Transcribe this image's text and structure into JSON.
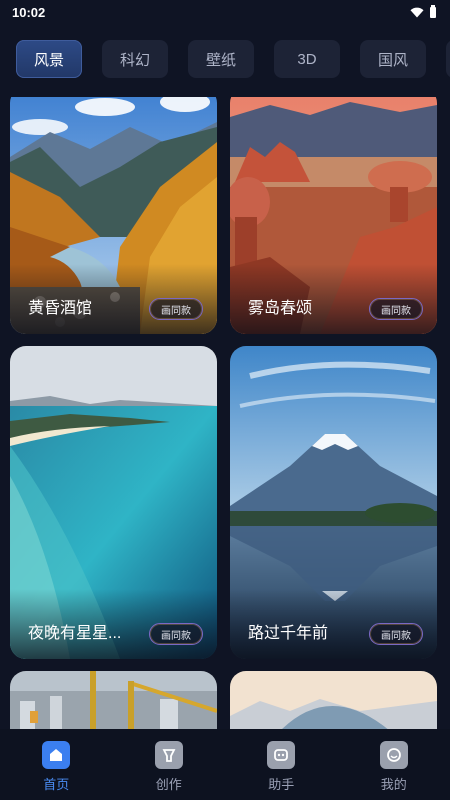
{
  "status": {
    "time": "10:02"
  },
  "tabs": [
    {
      "label": "风景",
      "active": true
    },
    {
      "label": "科幻"
    },
    {
      "label": "壁纸"
    },
    {
      "label": "3D"
    },
    {
      "label": "国风"
    },
    {
      "label": ""
    }
  ],
  "cards": [
    {
      "title": "黄昏酒馆",
      "button": "画同款",
      "scene": "autumn-mountain-river"
    },
    {
      "title": "雾岛春颂",
      "button": "画同款",
      "scene": "desert-red-rocks"
    },
    {
      "title": "夜晚有星星...",
      "button": "画同款",
      "scene": "turquoise-sea-coast"
    },
    {
      "title": "路过千年前",
      "button": "画同款",
      "scene": "snow-volcano-lake"
    },
    {
      "title": "",
      "button": "",
      "scene": "construction-crane-city"
    },
    {
      "title": "",
      "button": "",
      "scene": "misty-mountain"
    }
  ],
  "nav": [
    {
      "label": "首页",
      "icon": "home-icon",
      "active": true
    },
    {
      "label": "创作",
      "icon": "create-icon"
    },
    {
      "label": "助手",
      "icon": "assistant-icon"
    },
    {
      "label": "我的",
      "icon": "profile-icon"
    }
  ],
  "colors": {
    "accent": "#3b7ff0",
    "background": "#0f1424",
    "tab_bg": "#1d2336"
  }
}
